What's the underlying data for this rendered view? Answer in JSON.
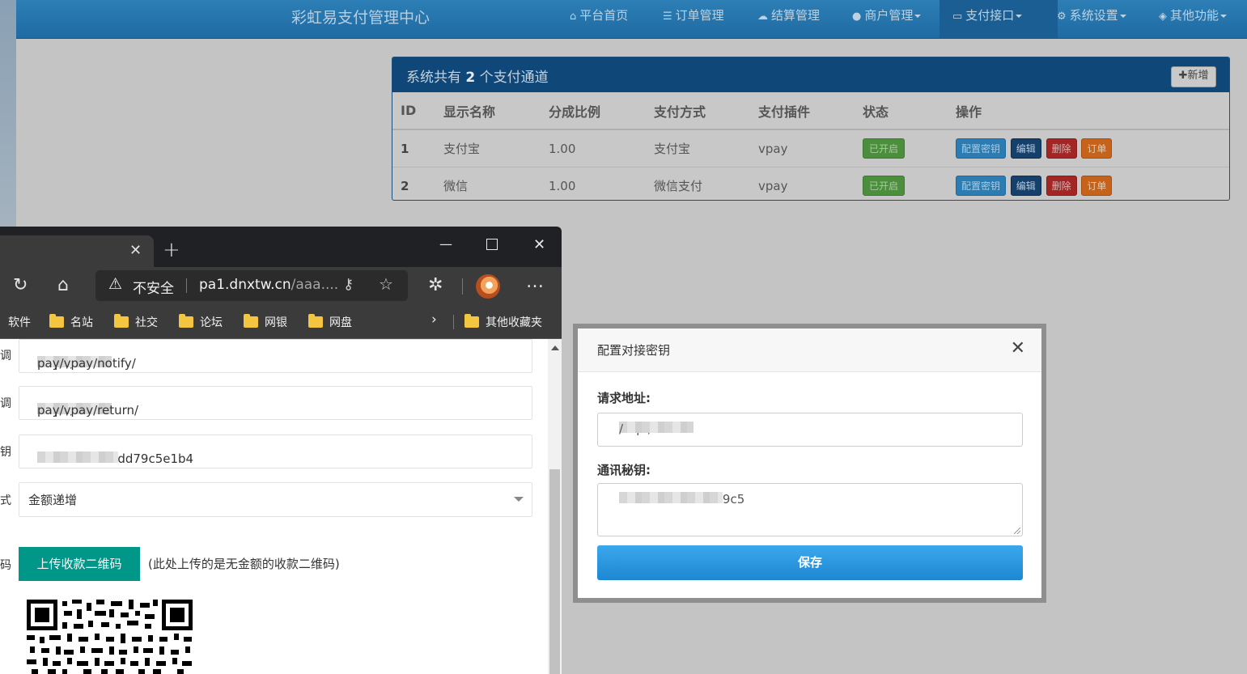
{
  "navbar": {
    "brand": "彩虹易支付管理中心",
    "items": [
      {
        "label": "平台首页",
        "icon": "home-icon"
      },
      {
        "label": "订单管理",
        "icon": "list-icon"
      },
      {
        "label": "结算管理",
        "icon": "cloud-icon"
      },
      {
        "label": "商户管理",
        "icon": "user-icon"
      },
      {
        "label": "支付接口",
        "icon": "credit-card-icon"
      },
      {
        "label": "系统设置",
        "icon": "gear-icon"
      },
      {
        "label": "其他功能",
        "icon": "cube-icon"
      }
    ]
  },
  "panel": {
    "title_prefix": "系统共有",
    "count": "2",
    "title_suffix": "个支付通道",
    "add_label": "新增",
    "columns": [
      "ID",
      "显示名称",
      "分成比例",
      "支付方式",
      "支付插件",
      "状态",
      "操作"
    ],
    "rows": [
      {
        "id": "1",
        "name": "支付宝",
        "ratio": "1.00",
        "method": "支付宝",
        "plugin": "vpay",
        "status": "已开启"
      },
      {
        "id": "2",
        "name": "微信",
        "ratio": "1.00",
        "method": "微信支付",
        "plugin": "vpay",
        "status": "已开启"
      }
    ],
    "actions": {
      "key": "配置密钥",
      "edit": "编辑",
      "delete": "删除",
      "order": "订单"
    }
  },
  "browser": {
    "security": "不安全",
    "url_host": "pa1.dnxtw.cn",
    "url_path": "/aaa....",
    "bookmarks": [
      "软件",
      "名站",
      "社交",
      "论坛",
      "网银",
      "网盘"
    ],
    "other_bookmarks": "其他收藏夹",
    "content": {
      "notify_prefix": "http://",
      "notify_suffix": "pay/vpay/notify/",
      "return_prefix": "http://",
      "return_suffix": "pay/vpay/return/",
      "key_value": "f54a0a48ea3dd79c5e1b4",
      "mode_value": "金额递增",
      "upload_label": "上传收款二维码",
      "upload_hint": "(此处上传的是无金额的收款二维码)",
      "left_labels": [
        "调",
        "调",
        "钥",
        "式",
        "码"
      ]
    }
  },
  "modal": {
    "title": "配置对接密钥",
    "url_label": "请求地址:",
    "url_prefix": "http:/",
    "url_suffix": "/",
    "key_label": "通讯秘钥:",
    "key_value": "f54a0a48ea3dd79c5",
    "save_label": "保存"
  }
}
